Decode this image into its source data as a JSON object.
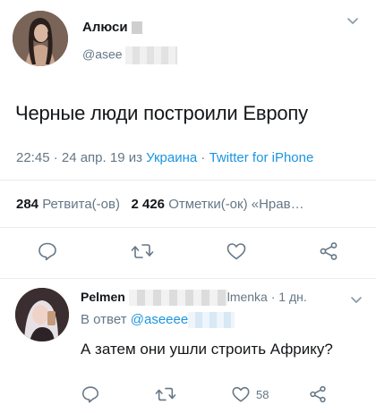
{
  "tweet": {
    "author_name": "Алюси",
    "author_handle": "@asee",
    "text": "Черные люди построили Европу",
    "time": "22:45 · 24 апр. 19 из ",
    "location": "Украина",
    "separator": " · ",
    "source": "Twitter for iPhone",
    "retweets_count": "284",
    "retweets_label": "Ретвита(-ов)",
    "likes_count": "2 426",
    "likes_label": "Отметки(-ок) «Нрав…"
  },
  "reply": {
    "author_name": "Pelmen",
    "author_handle_suffix": "lmenka · 1 дн.",
    "reply_to_prefix": "В ответ ",
    "reply_to_handle": "@aseeee",
    "text": "А затем они ушли строить Африку?",
    "likes_count": "58"
  },
  "icons": {
    "reply": "reply-icon",
    "retweet": "retweet-icon",
    "like": "heart-icon",
    "share": "share-icon",
    "more": "chevron-down-icon"
  },
  "colors": {
    "link": "#1b95e0",
    "secondary_text": "#657786",
    "primary_text": "#14171a",
    "divider": "#e6ecf0"
  }
}
